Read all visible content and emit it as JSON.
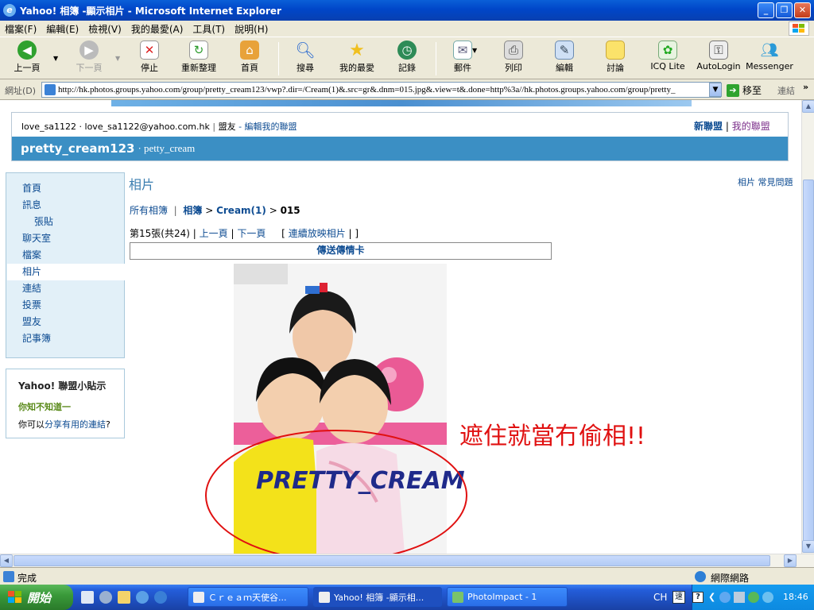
{
  "window": {
    "title": "Yahoo! 相簿 -顯示相片 - Microsoft Internet Explorer",
    "min": "_",
    "max": "❐",
    "close": "✕"
  },
  "menu": [
    "檔案(F)",
    "編輯(E)",
    "檢視(V)",
    "我的最愛(A)",
    "工具(T)",
    "說明(H)"
  ],
  "toolbar": {
    "back": "上一頁",
    "forward": "下一頁",
    "stop": "停止",
    "refresh": "重新整理",
    "home": "首頁",
    "search": "搜尋",
    "favorites": "我的最愛",
    "history": "記錄",
    "mail": "郵件",
    "print": "列印",
    "edit": "編輯",
    "discuss": "討論",
    "icq": "ICQ Lite",
    "autologin": "AutoLogin",
    "messenger": "Messenger"
  },
  "address": {
    "label": "網址(D)",
    "url": "http://hk.photos.groups.yahoo.com/group/pretty_cream123/vwp?.dir=/Cream(1)&.src=gr&.dnm=015.jpg&.view=t&.done=http%3a//hk.photos.groups.yahoo.com/group/pretty_",
    "go": "移至",
    "links": "連結",
    "more": "»"
  },
  "header": {
    "user": "love_sa1122 · love_sa1122@yahoo.com.hk",
    "sep": "|",
    "friends": "盟友",
    "edit_link": "- 編輯我的聯盟",
    "new_group": "新聯盟",
    "my_groups": "我的聯盟",
    "group_name": "pretty_cream123",
    "group_alias": "· petty_cream"
  },
  "sidebar": {
    "items": [
      "首頁",
      "訊息",
      "張貼",
      "聊天室",
      "檔案",
      "相片",
      "連結",
      "投票",
      "盟友",
      "記事簿"
    ],
    "selected": "相片"
  },
  "tips": {
    "title": "Yahoo! 聯盟小貼示",
    "subtitle": "你知不知道一",
    "text_pre": "你可以",
    "text_link": "分享有用的連結",
    "text_post": "?"
  },
  "main": {
    "heading": "相片",
    "faq_pre": "相片",
    "faq_link": "常見問題",
    "crumbs": {
      "all": "所有相簿",
      "album": "相簿",
      "folder": "Cream(1)",
      "current": "015",
      "sep": ">"
    },
    "pager": {
      "count": "第15張(共24)",
      "prev": "上一頁",
      "next": "下一頁",
      "slideshow": "連續放映相片",
      "bar": "|",
      "lb": "[",
      "rb": "]"
    },
    "send_card": "傳送傳情卡",
    "watermark": "PRETTY_CREAM",
    "annotation": "遮住就當冇偷相!!"
  },
  "status": {
    "text": "完成",
    "zone": "網際網路"
  },
  "taskbar": {
    "start": "開始",
    "tasks": [
      "Ｃｒｅａｍ天使谷...",
      "Yahoo! 相簿 -顯示相...",
      "PhotoImpact - 1"
    ],
    "lang": "CH",
    "clock": "18:46"
  }
}
